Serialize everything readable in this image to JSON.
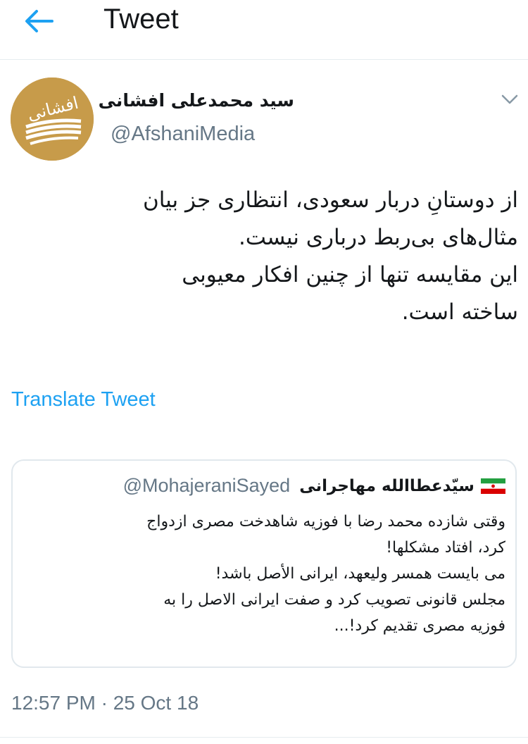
{
  "header": {
    "title": "Tweet",
    "back_icon": "arrow-left-icon",
    "accent_color": "#1da1f2"
  },
  "tweet": {
    "avatar": {
      "icon": "afshani-logo-icon",
      "logo_text": "افشانی",
      "background_color": "#c79b4a"
    },
    "display_name": "سید محمدعلی افشانی",
    "username": "@AfshaniMedia",
    "menu_icon": "chevron-down-icon",
    "text_lines": [
      "از دوستانِ دربار سعودی، انتظاری جز بیان",
      "مثال‌های بی‌ربط درباری نیست.",
      "این مقایسه تنها از چنین افکار معیوبی",
      "ساخته است."
    ],
    "translate_label": "Translate Tweet",
    "timestamp": "12:57 PM · 25 Oct 18"
  },
  "quoted_tweet": {
    "display_name": "سیّدعطاالله مهاجرانی",
    "flag_icon": "iran-flag-icon",
    "username": "@MohajeraniSayed",
    "text_lines": [
      "وقتی شازده محمد رضا با فوزیه شاهدخت مصری ازدواج",
      "کرد، افتاد مشکلها!",
      "می بایست همسر ولیعهد، ایرانی الأصل باشد!",
      "مجلس قانونی تصویب کرد و صفت ایرانی الاصل را به",
      "فوزیه مصری تقدیم کرد!..."
    ]
  }
}
